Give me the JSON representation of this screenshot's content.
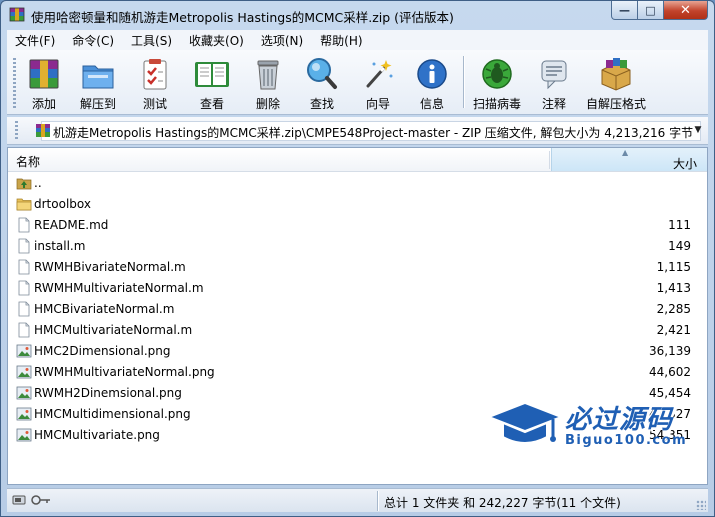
{
  "window": {
    "title": "使用哈密顿量和随机游走Metropolis Hastings的MCMC采样.zip (评估版本)",
    "minimize_glyph": "—",
    "maximize_glyph": "□",
    "close_glyph": "✕"
  },
  "menu": [
    "文件(F)",
    "命令(C)",
    "工具(S)",
    "收藏夹(O)",
    "选项(N)",
    "帮助(H)"
  ],
  "toolbar": {
    "buttons": [
      {
        "label": "添加",
        "icon": "add-archive-icon"
      },
      {
        "label": "解压到",
        "icon": "extract-to-icon"
      },
      {
        "label": "测试",
        "icon": "test-icon"
      },
      {
        "label": "查看",
        "icon": "view-icon"
      },
      {
        "label": "删除",
        "icon": "delete-icon"
      },
      {
        "label": "查找",
        "icon": "find-icon"
      },
      {
        "label": "向导",
        "icon": "wizard-icon"
      },
      {
        "label": "信息",
        "icon": "info-icon"
      },
      {
        "label": "扫描病毒",
        "icon": "virus-scan-icon"
      },
      {
        "label": "注释",
        "icon": "comment-icon"
      },
      {
        "label": "自解压格式",
        "icon": "sfx-icon"
      }
    ]
  },
  "address": {
    "path": "机游走Metropolis Hastings的MCMC采样.zip\\CMPE548Project-master - ZIP 压缩文件, 解包大小为 4,213,216 字节"
  },
  "columns": {
    "name": "名称",
    "size": "大小"
  },
  "files": [
    {
      "name": "..",
      "size": "",
      "type": "up"
    },
    {
      "name": "drtoolbox",
      "size": "",
      "type": "folder"
    },
    {
      "name": "README.md",
      "size": "111",
      "type": "file"
    },
    {
      "name": "install.m",
      "size": "149",
      "type": "file"
    },
    {
      "name": "RWMHBivariateNormal.m",
      "size": "1,115",
      "type": "file"
    },
    {
      "name": "RWMHMultivariateNormal.m",
      "size": "1,413",
      "type": "file"
    },
    {
      "name": "HMCBivariateNormal.m",
      "size": "2,285",
      "type": "file"
    },
    {
      "name": "HMCMultivariateNormal.m",
      "size": "2,421",
      "type": "file"
    },
    {
      "name": "HMC2Dimensional.png",
      "size": "36,139",
      "type": "image"
    },
    {
      "name": "RWMHMultivariateNormal.png",
      "size": "44,602",
      "type": "image"
    },
    {
      "name": "RWMH2Dinemsional.png",
      "size": "45,454",
      "type": "image"
    },
    {
      "name": "HMCMultidimensional.png",
      "size": "47,327",
      "type": "image"
    },
    {
      "name": "HMCMultivariate.png",
      "size": "54,351",
      "type": "image"
    }
  ],
  "watermark": {
    "cn": "必过源码",
    "en": "Biguo100.com"
  },
  "status": {
    "text": "总计 1 文件夹 和 242,227 字节(11 个文件)"
  },
  "colors": {
    "accent": "#1f5fb4",
    "title_bg": "#c6d9ee",
    "close_red": "#c2432b"
  }
}
